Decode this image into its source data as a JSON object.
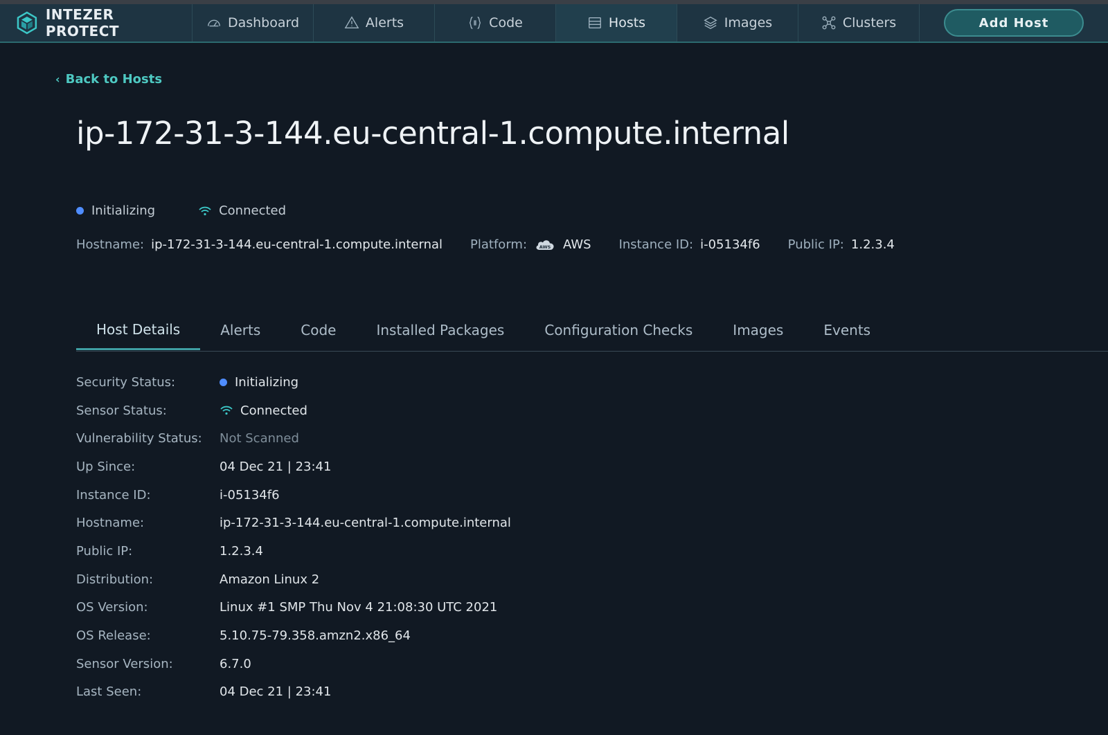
{
  "nav": {
    "brand": "INTEZER PROTECT",
    "items": [
      {
        "label": "Dashboard",
        "icon": "dashboard-gauge-icon"
      },
      {
        "label": "Alerts",
        "icon": "warning-triangle-icon"
      },
      {
        "label": "Code",
        "icon": "code-braces-icon"
      },
      {
        "label": "Hosts",
        "icon": "server-icon"
      },
      {
        "label": "Images",
        "icon": "layers-icon"
      },
      {
        "label": "Clusters",
        "icon": "cluster-nodes-icon"
      }
    ],
    "active": "Hosts",
    "add_host_label": "Add Host"
  },
  "back_link": "Back to Hosts",
  "host": {
    "title": "ip-172-31-3-144.eu-central-1.compute.internal",
    "security_status": "Initializing",
    "sensor_status": "Connected",
    "meta": {
      "hostname_label": "Hostname:",
      "hostname": "ip-172-31-3-144.eu-central-1.compute.internal",
      "platform_label": "Platform:",
      "platform": "AWS",
      "instance_label": "Instance ID:",
      "instance_id": "i-05134f6",
      "ip_label": "Public IP:",
      "public_ip": "1.2.3.4"
    }
  },
  "tabs": [
    "Host Details",
    "Alerts",
    "Code",
    "Installed Packages",
    "Configuration Checks",
    "Images",
    "Events"
  ],
  "active_tab": "Host Details",
  "details": [
    {
      "label": "Security Status:",
      "value": "Initializing"
    },
    {
      "label": "Sensor Status:",
      "value": "Connected"
    },
    {
      "label": "Vulnerability Status:",
      "value": "Not Scanned"
    },
    {
      "label": "Up Since:",
      "value": "04 Dec 21 | 23:41"
    },
    {
      "label": "Instance ID:",
      "value": "i-05134f6"
    },
    {
      "label": "Hostname:",
      "value": "ip-172-31-3-144.eu-central-1.compute.internal"
    },
    {
      "label": "Public IP:",
      "value": "1.2.3.4"
    },
    {
      "label": "Distribution:",
      "value": "Amazon Linux 2"
    },
    {
      "label": "OS Version:",
      "value": "Linux #1 SMP Thu Nov 4 21:08:30 UTC 2021"
    },
    {
      "label": "OS Release:",
      "value": "5.10.75-79.358.amzn2.x86_64"
    },
    {
      "label": "Sensor Version:",
      "value": "6.7.0"
    },
    {
      "label": "Last Seen:",
      "value": "04 Dec 21 | 23:41"
    }
  ],
  "colors": {
    "background": "#111923",
    "navbar": "#1e3442",
    "accent": "#4ec9c2",
    "status_dot": "#4f8dff"
  }
}
